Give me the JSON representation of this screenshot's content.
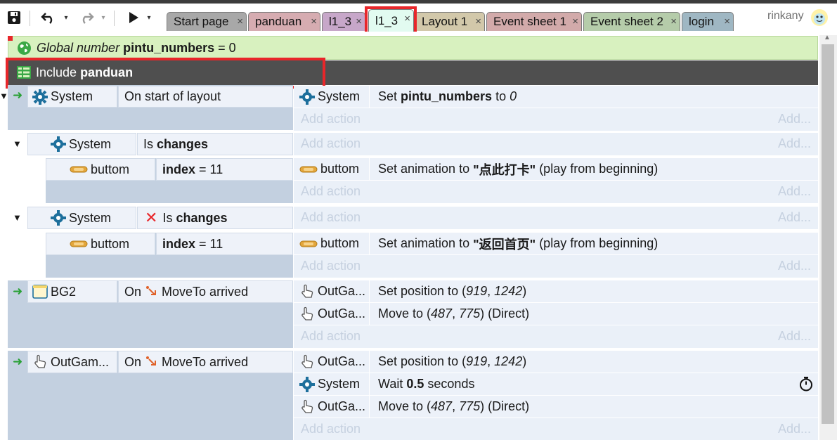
{
  "toolbar": {
    "save_icon": "save-icon",
    "undo_icon": "undo-icon",
    "redo_icon": "redo-icon",
    "run_icon": "play-icon",
    "caret": "▾"
  },
  "tabs": [
    {
      "label": "Start page",
      "color": "#a8a8a8",
      "active": false
    },
    {
      "label": "panduan",
      "color": "#d6acb1",
      "active": false
    },
    {
      "label": "l1_3",
      "color": "#c7a7c9",
      "active": false
    },
    {
      "label": "l1_3",
      "color": "#e2fbf0",
      "active": true
    },
    {
      "label": "Layout 1",
      "color": "#d2c8aa",
      "active": false
    },
    {
      "label": "Event sheet 1",
      "color": "#d2aaaa",
      "active": false
    },
    {
      "label": "Event sheet 2",
      "color": "#b5ccaa",
      "active": false
    },
    {
      "label": "login",
      "color": "#9fb7c3",
      "active": false
    }
  ],
  "tab_close": "×",
  "user": {
    "name": "rinkany",
    "avatar": "avatar-icon"
  },
  "global": {
    "prefix": "Global number",
    "name": "pintu_numbers",
    "rest": "= 0",
    "icon": "globe-icon"
  },
  "include": {
    "prefix": "Include",
    "name": "panduan",
    "icon": "event-sheet-icon"
  },
  "add_action": "Add action",
  "add_short": "Add...",
  "events": {
    "e1": {
      "cond_obj": "System",
      "cond_text": "On start of layout",
      "action_obj": "System",
      "action_pre": "Set",
      "action_var": "pintu_numbers",
      "action_mid": "to",
      "action_val": "0"
    },
    "e2": {
      "cond_obj": "System",
      "cond_text_pre": "Is",
      "cond_text_b": "changes",
      "sub_obj": "buttom",
      "sub_var": "index",
      "sub_rest": "= 11",
      "action_obj": "buttom",
      "action_pre": "Set animation to",
      "action_val": "\"点此打卡\"",
      "action_post": "(play from beginning)"
    },
    "e3": {
      "cond_obj": "System",
      "cond_text_pre": "Is",
      "cond_text_b": "changes",
      "invert_mark": "✕",
      "sub_obj": "buttom",
      "sub_var": "index",
      "sub_rest": "= 11",
      "action_obj": "buttom",
      "action_pre": "Set animation to",
      "action_val": "\"返回首页\"",
      "action_post": "(play from beginning)"
    },
    "e4": {
      "cond_obj": "BG2",
      "cond_text": "On",
      "cond_text_post": "MoveTo arrived",
      "a1_obj": "OutGa...",
      "a1_pre": "Set position to (",
      "a1_x": "919",
      "a1_sep": ",",
      "a1_y": "1242",
      "a1_post": ")",
      "a2_obj": "OutGa...",
      "a2_pre": "Move to (",
      "a2_x": "487",
      "a2_sep": ",",
      "a2_y": "775",
      "a2_post": ") (Direct)"
    },
    "e5": {
      "cond_obj": "OutGam...",
      "cond_text": "On",
      "cond_text_post": "MoveTo arrived",
      "a1_obj": "OutGa...",
      "a1_pre": "Set position to (",
      "a1_x": "919",
      "a1_sep": ",",
      "a1_y": "1242",
      "a1_post": ")",
      "a2_obj": "System",
      "a2_pre": "Wait",
      "a2_val": "0.5",
      "a2_post": "seconds",
      "a3_obj": "OutGa...",
      "a3_pre": "Move to (",
      "a3_x": "487",
      "a3_sep": ",",
      "a3_y": "775",
      "a3_post": ") (Direct)"
    }
  }
}
